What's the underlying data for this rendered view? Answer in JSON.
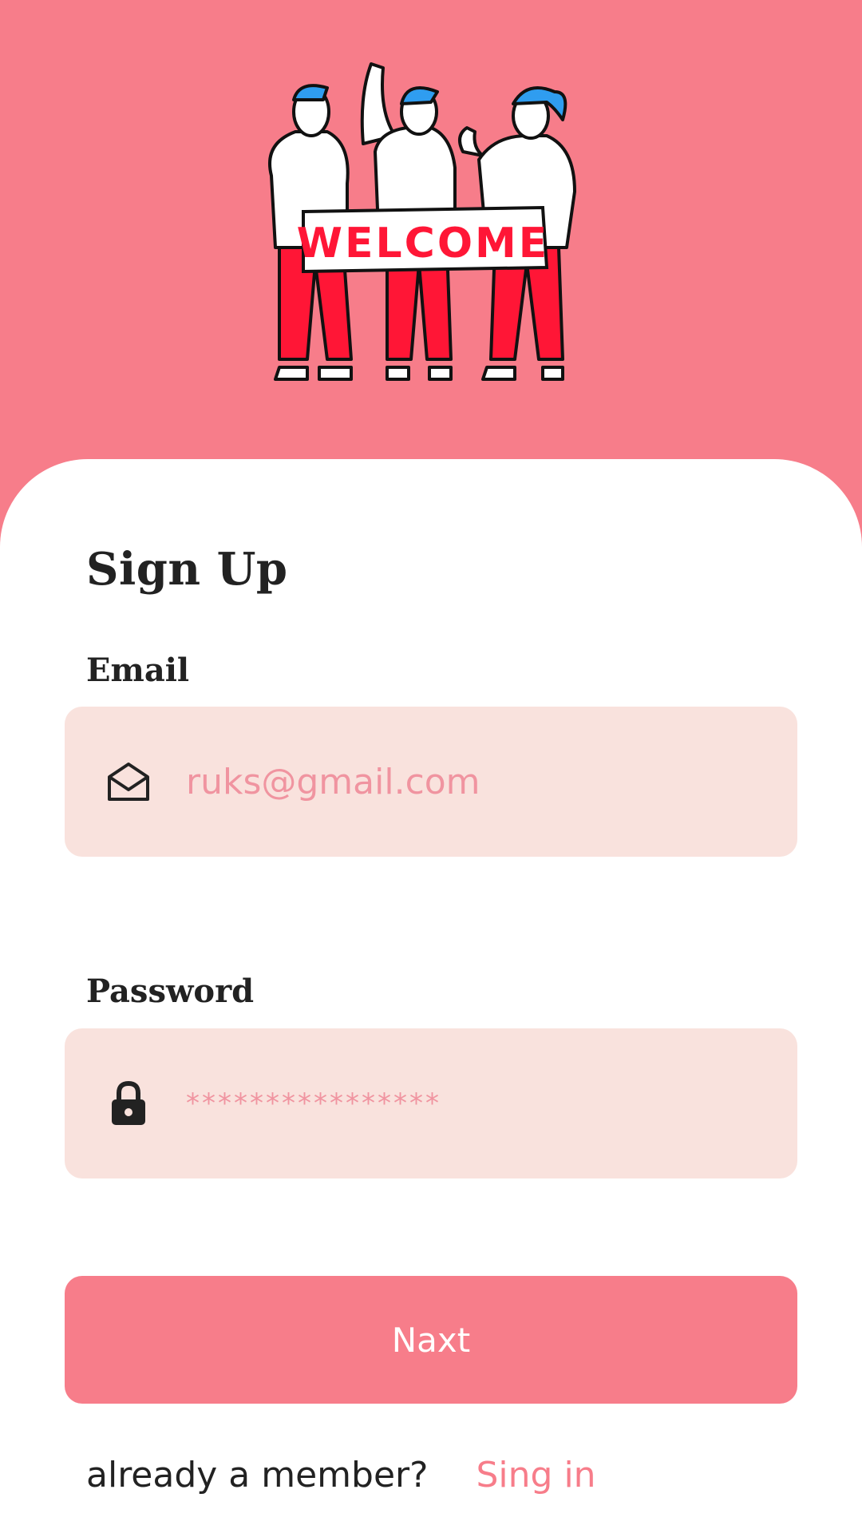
{
  "hero": {
    "banner_text": "WELCOME"
  },
  "colors": {
    "primary": "#f77d8a",
    "field_bg": "#f9e2dd",
    "placeholder": "#f094a0",
    "hair": "#2f9df0",
    "pants": "#ff1636"
  },
  "form": {
    "title": "Sign Up",
    "email": {
      "label": "Email",
      "placeholder": "ruks@gmail.com",
      "icon": "mail-icon"
    },
    "password": {
      "label": "Password",
      "value": "****************",
      "icon": "lock-icon"
    },
    "submit_label": "Naxt"
  },
  "footer": {
    "prompt": "already a member?",
    "link_label": "Sing in"
  }
}
